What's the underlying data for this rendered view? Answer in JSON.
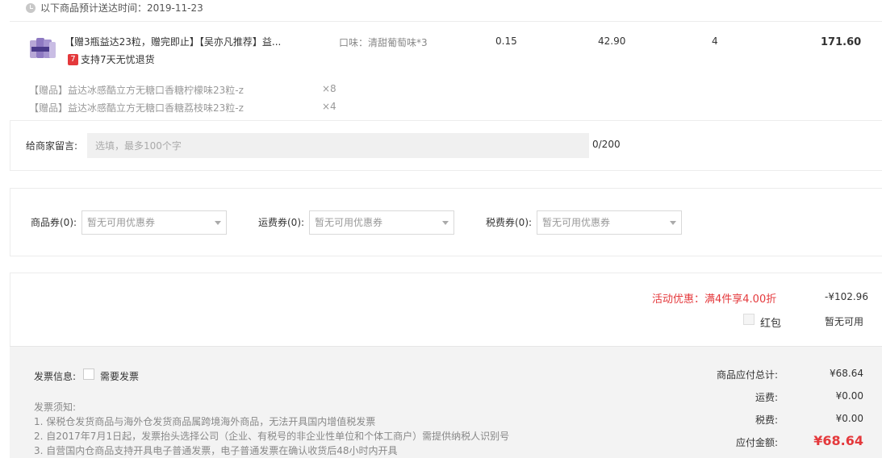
{
  "delivery": {
    "text": "以下商品预计送达时间：2019-11-23"
  },
  "product": {
    "title": "【赠3瓶益达23粒，赠完即止】【吴亦凡推荐】益...",
    "return_policy": "支持7天无忧退货",
    "return_badge": "7",
    "spec": "口味：清甜葡萄味*3",
    "tax": "0.15",
    "price": "42.90",
    "qty": "4",
    "total": "171.60"
  },
  "gifts": [
    {
      "name": "【赠品】益达冰感酷立方无糖口香糖柠檬味23粒-z",
      "qty": "×8"
    },
    {
      "name": "【赠品】益达冰感酷立方无糖口香糖荔枝味23粒-z",
      "qty": "×4"
    }
  ],
  "message": {
    "label": "给商家留言:",
    "placeholder": "选填，最多100个字",
    "count": "0/200"
  },
  "coupons": [
    {
      "label": "商品券(0):",
      "value": "暂无可用优惠券"
    },
    {
      "label": "运费券(0):",
      "value": "暂无可用优惠券"
    },
    {
      "label": "税费券(0):",
      "value": "暂无可用优惠券"
    }
  ],
  "promo": {
    "label": "活动优惠：满4件享4.00折",
    "value": "-¥102.96",
    "hongbao_label": "红包",
    "hongbao_value": "暂无可用"
  },
  "invoice": {
    "label": "发票信息:",
    "need_label": "需要发票",
    "notice_title": "发票须知:",
    "notices": [
      "1. 保税仓发货商品与海外仓发货商品属跨境海外商品，无法开具国内增值税发票",
      "2. 自2017年7月1日起，发票抬头选择公司（企业、有税号的非企业性单位和个体工商户）需提供纳税人识别号",
      "3. 自营国内仓商品支持开具电子普通发票，电子普通发票在确认收货后48小时内开具"
    ]
  },
  "summary": {
    "goods_label": "商品应付总计:",
    "goods_value": "¥68.64",
    "shipping_label": "运费:",
    "shipping_value": "¥0.00",
    "tax_label": "税费:",
    "tax_value": "¥0.00",
    "pay_label": "应付金额:",
    "pay_value": "¥68.64"
  },
  "colors": {
    "accent": "#e4393c",
    "muted": "#999999",
    "panel": "#f3f3f3"
  }
}
